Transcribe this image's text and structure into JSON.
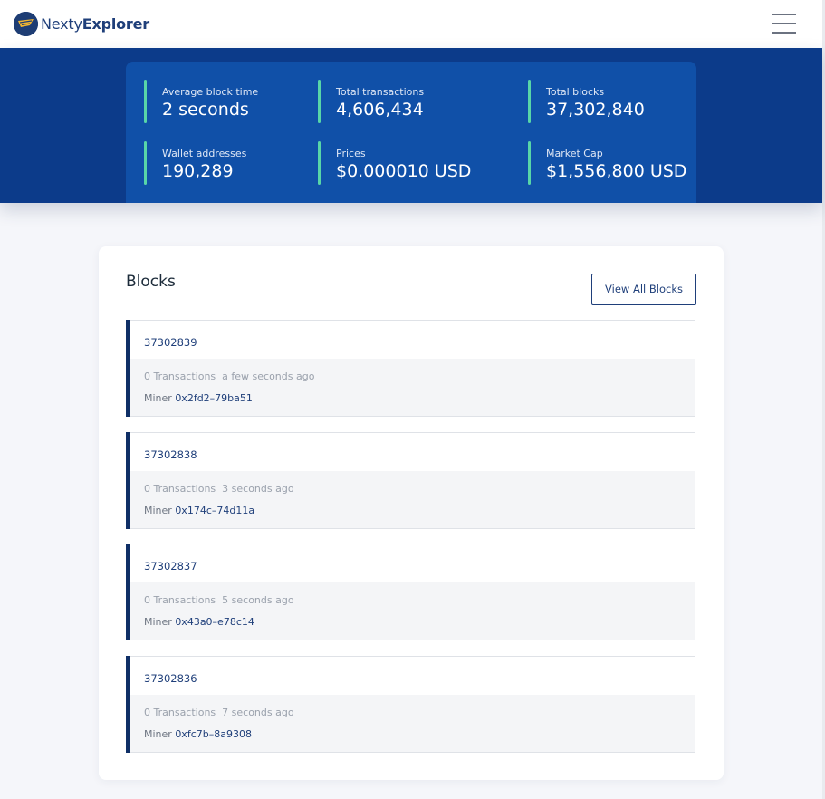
{
  "brand": {
    "name_light": "Nexty",
    "name_bold": "Explorer"
  },
  "header": {
    "menu_icon": "hamburger-icon"
  },
  "stats": [
    {
      "label": "Average block time",
      "value": "2 seconds"
    },
    {
      "label": "Total transactions",
      "value": "4,606,434"
    },
    {
      "label": "Total blocks",
      "value": "37,302,840"
    },
    {
      "label": "Wallet addresses",
      "value": "190,289"
    },
    {
      "label": "Prices",
      "value": "$0.000010 USD"
    },
    {
      "label": "Market Cap",
      "value": "$1,556,800 USD"
    }
  ],
  "blocks_panel": {
    "title": "Blocks",
    "view_all_label": "View All Blocks",
    "miner_label": "Miner",
    "items": [
      {
        "number": "37302839",
        "transactions": "0 Transactions",
        "age": "a few seconds ago",
        "miner": "0x2fd2–79ba51"
      },
      {
        "number": "37302838",
        "transactions": "0 Transactions",
        "age": "3 seconds ago",
        "miner": "0x174c–74d11a"
      },
      {
        "number": "37302837",
        "transactions": "0 Transactions",
        "age": "5 seconds ago",
        "miner": "0x43a0–e78c14"
      },
      {
        "number": "37302836",
        "transactions": "0 Transactions",
        "age": "7 seconds ago",
        "miner": "0xfc7b–8a9308"
      }
    ]
  },
  "colors": {
    "hero_bg": "#0c3b8a",
    "stats_card_bg": "#1050a8",
    "stat_accent": "#58d6a8",
    "brand_navy": "#1f3f7a",
    "block_accent": "#0f2f66"
  }
}
